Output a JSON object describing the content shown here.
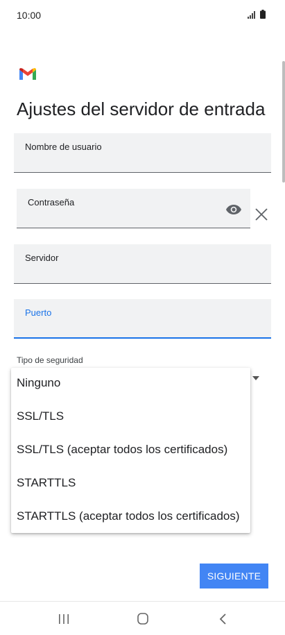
{
  "status_bar": {
    "time": "10:00",
    "signal_icon": "signal-icon",
    "battery_icon": "battery-icon"
  },
  "app": {
    "logo": "gmail-logo"
  },
  "page": {
    "title": "Ajustes del servidor de entrada"
  },
  "fields": {
    "username": {
      "label": "Nombre de usuario",
      "value": ""
    },
    "password": {
      "label": "Contraseña",
      "value": ""
    },
    "server": {
      "label": "Servidor",
      "value": ""
    },
    "port": {
      "label": "Puerto",
      "value": ""
    }
  },
  "security": {
    "label": "Tipo de seguridad",
    "options": [
      "Ninguno",
      "SSL/TLS",
      "SSL/TLS (aceptar todos los certificados)",
      "STARTTLS",
      "STARTTLS (aceptar todos los certificados)"
    ]
  },
  "actions": {
    "next_label": "SIGUIENTE"
  },
  "colors": {
    "accent": "#1a73e8",
    "button": "#4285f4",
    "field_bg": "#f1f2f3"
  },
  "nav": {
    "recent_icon": "recent-apps-icon",
    "home_icon": "home-icon",
    "back_icon": "back-icon"
  }
}
